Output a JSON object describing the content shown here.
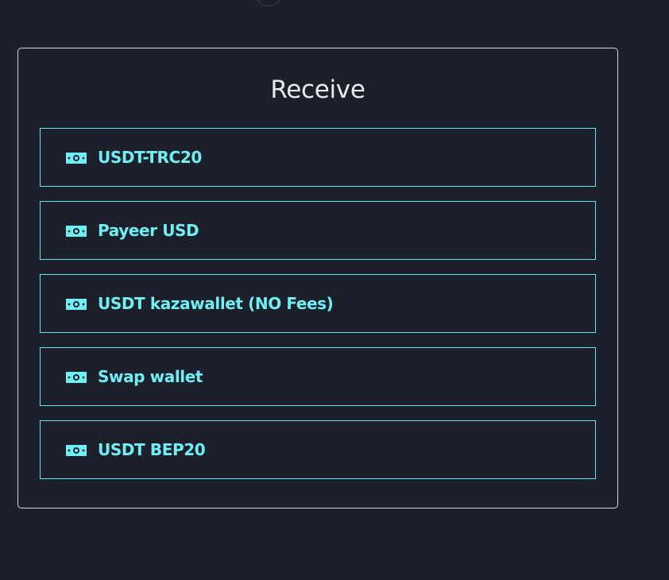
{
  "receive_panel": {
    "title": "Receive",
    "accent_color": "#5fe6ee",
    "items": [
      {
        "label": "USDT-TRC20",
        "icon": "money-bill-icon"
      },
      {
        "label": "Payeer USD",
        "icon": "money-bill-icon"
      },
      {
        "label": "USDT kazawallet (NO Fees)",
        "icon": "money-bill-icon"
      },
      {
        "label": "Swap wallet",
        "icon": "money-bill-icon"
      },
      {
        "label": "USDT BEP20",
        "icon": "money-bill-icon"
      }
    ]
  }
}
